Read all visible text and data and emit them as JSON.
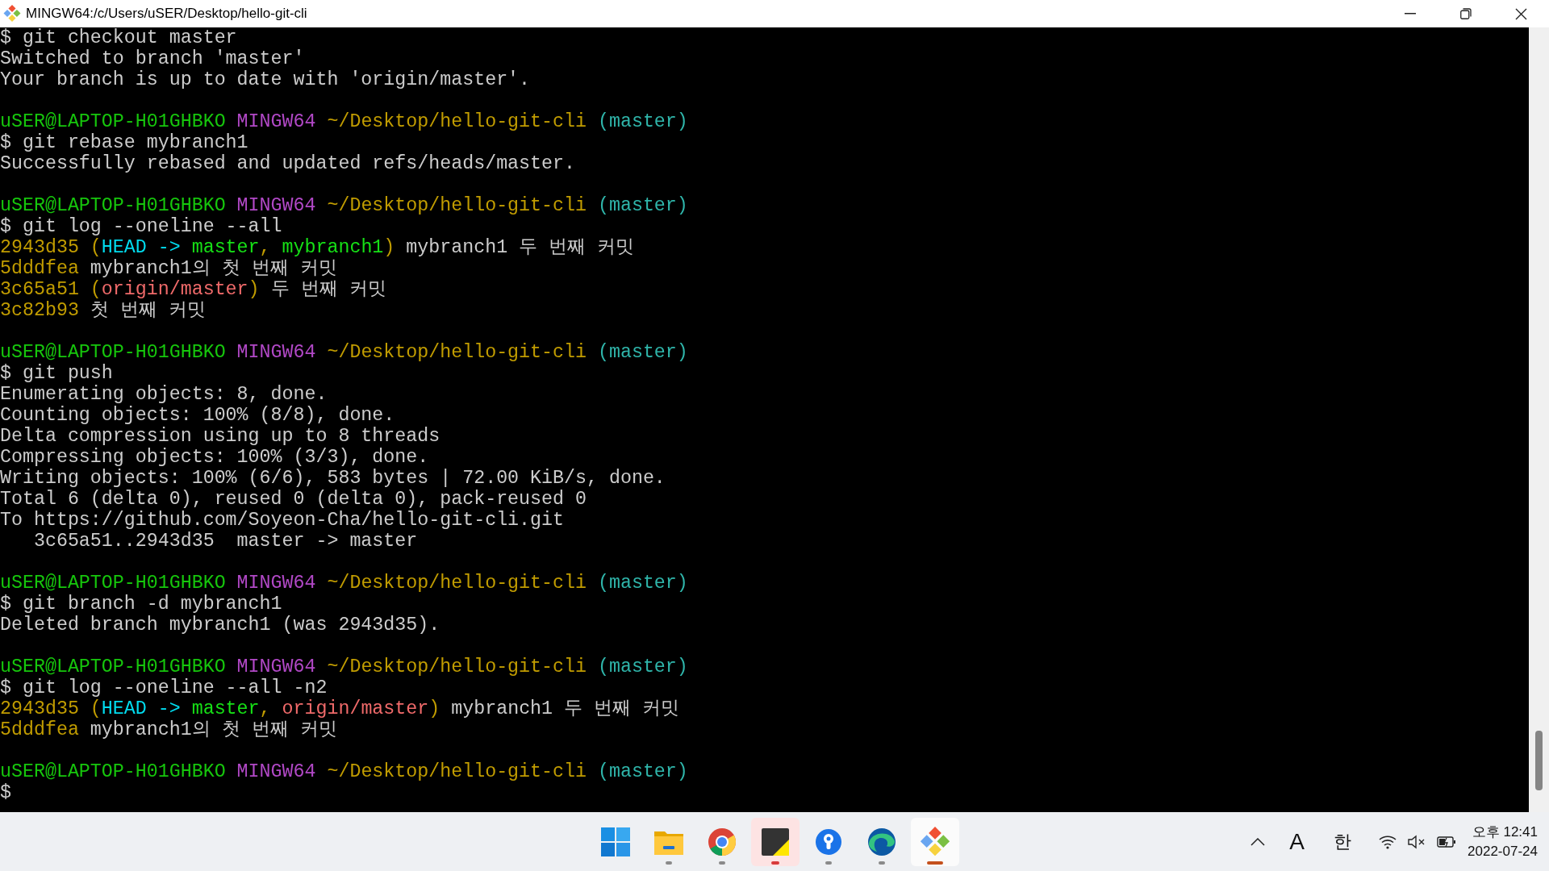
{
  "window": {
    "title": "MINGW64:/c/Users/uSER/Desktop/hello-git-cli"
  },
  "terminal": {
    "lines": [
      {
        "kind": "text",
        "segments": [
          {
            "text": "$ git checkout master",
            "color": "#cccccc"
          }
        ]
      },
      {
        "kind": "text",
        "segments": [
          {
            "text": "Switched to branch 'master'",
            "color": "#cccccc"
          }
        ]
      },
      {
        "kind": "text",
        "segments": [
          {
            "text": "Your branch is up to date with 'origin/master'.",
            "color": "#cccccc"
          }
        ]
      },
      {
        "kind": "blank"
      },
      {
        "kind": "text",
        "segments": [
          {
            "text": "uSER@LAPTOP-H01GHBKO ",
            "color": "#16c60c"
          },
          {
            "text": "MINGW64 ",
            "color": "#b148c6"
          },
          {
            "text": "~/Desktop/hello-git-cli ",
            "color": "#c19c00"
          },
          {
            "text": "(master)",
            "color": "#2fb5aa"
          }
        ]
      },
      {
        "kind": "text",
        "segments": [
          {
            "text": "$ git rebase mybranch1",
            "color": "#cccccc"
          }
        ]
      },
      {
        "kind": "text",
        "segments": [
          {
            "text": "Successfully rebased and updated refs/heads/master.",
            "color": "#cccccc"
          }
        ]
      },
      {
        "kind": "blank"
      },
      {
        "kind": "text",
        "segments": [
          {
            "text": "uSER@LAPTOP-H01GHBKO ",
            "color": "#16c60c"
          },
          {
            "text": "MINGW64 ",
            "color": "#b148c6"
          },
          {
            "text": "~/Desktop/hello-git-cli ",
            "color": "#c19c00"
          },
          {
            "text": "(master)",
            "color": "#2fb5aa"
          }
        ]
      },
      {
        "kind": "text",
        "segments": [
          {
            "text": "$ git log --oneline --all",
            "color": "#cccccc"
          }
        ]
      },
      {
        "kind": "text",
        "segments": [
          {
            "text": "2943d35 (",
            "color": "#c19c00"
          },
          {
            "text": "HEAD -> ",
            "color": "#00dcef"
          },
          {
            "text": "master",
            "color": "#16e016"
          },
          {
            "text": ", ",
            "color": "#c19c00"
          },
          {
            "text": "mybranch1",
            "color": "#16e016"
          },
          {
            "text": ")",
            "color": "#c19c00"
          },
          {
            "text": " mybranch1 두 번째 커밋",
            "color": "#cccccc"
          }
        ]
      },
      {
        "kind": "text",
        "segments": [
          {
            "text": "5dddfea ",
            "color": "#c19c00"
          },
          {
            "text": "mybranch1의 첫 번째 커밋",
            "color": "#cccccc"
          }
        ]
      },
      {
        "kind": "text",
        "segments": [
          {
            "text": "3c65a51 (",
            "color": "#c19c00"
          },
          {
            "text": "origin/master",
            "color": "#f06a6a"
          },
          {
            "text": ")",
            "color": "#c19c00"
          },
          {
            "text": " 두 번째 커밋",
            "color": "#cccccc"
          }
        ]
      },
      {
        "kind": "text",
        "segments": [
          {
            "text": "3c82b93 ",
            "color": "#c19c00"
          },
          {
            "text": "첫 번째 커밋",
            "color": "#cccccc"
          }
        ]
      },
      {
        "kind": "blank"
      },
      {
        "kind": "text",
        "segments": [
          {
            "text": "uSER@LAPTOP-H01GHBKO ",
            "color": "#16c60c"
          },
          {
            "text": "MINGW64 ",
            "color": "#b148c6"
          },
          {
            "text": "~/Desktop/hello-git-cli ",
            "color": "#c19c00"
          },
          {
            "text": "(master)",
            "color": "#2fb5aa"
          }
        ]
      },
      {
        "kind": "text",
        "segments": [
          {
            "text": "$ git push",
            "color": "#cccccc"
          }
        ]
      },
      {
        "kind": "text",
        "segments": [
          {
            "text": "Enumerating objects: 8, done.",
            "color": "#cccccc"
          }
        ]
      },
      {
        "kind": "text",
        "segments": [
          {
            "text": "Counting objects: 100% (8/8), done.",
            "color": "#cccccc"
          }
        ]
      },
      {
        "kind": "text",
        "segments": [
          {
            "text": "Delta compression using up to 8 threads",
            "color": "#cccccc"
          }
        ]
      },
      {
        "kind": "text",
        "segments": [
          {
            "text": "Compressing objects: 100% (3/3), done.",
            "color": "#cccccc"
          }
        ]
      },
      {
        "kind": "text",
        "segments": [
          {
            "text": "Writing objects: 100% (6/6), 583 bytes | 72.00 KiB/s, done.",
            "color": "#cccccc"
          }
        ]
      },
      {
        "kind": "text",
        "segments": [
          {
            "text": "Total 6 (delta 0), reused 0 (delta 0), pack-reused 0",
            "color": "#cccccc"
          }
        ]
      },
      {
        "kind": "text",
        "segments": [
          {
            "text": "To https://github.com/Soyeon-Cha/hello-git-cli.git",
            "color": "#cccccc"
          }
        ]
      },
      {
        "kind": "text",
        "segments": [
          {
            "text": "   3c65a51..2943d35  master -> master",
            "color": "#cccccc"
          }
        ]
      },
      {
        "kind": "blank"
      },
      {
        "kind": "text",
        "segments": [
          {
            "text": "uSER@LAPTOP-H01GHBKO ",
            "color": "#16c60c"
          },
          {
            "text": "MINGW64 ",
            "color": "#b148c6"
          },
          {
            "text": "~/Desktop/hello-git-cli ",
            "color": "#c19c00"
          },
          {
            "text": "(master)",
            "color": "#2fb5aa"
          }
        ]
      },
      {
        "kind": "text",
        "segments": [
          {
            "text": "$ git branch -d mybranch1",
            "color": "#cccccc"
          }
        ]
      },
      {
        "kind": "text",
        "segments": [
          {
            "text": "Deleted branch mybranch1 (was 2943d35).",
            "color": "#cccccc"
          }
        ]
      },
      {
        "kind": "blank"
      },
      {
        "kind": "text",
        "segments": [
          {
            "text": "uSER@LAPTOP-H01GHBKO ",
            "color": "#16c60c"
          },
          {
            "text": "MINGW64 ",
            "color": "#b148c6"
          },
          {
            "text": "~/Desktop/hello-git-cli ",
            "color": "#c19c00"
          },
          {
            "text": "(master)",
            "color": "#2fb5aa"
          }
        ]
      },
      {
        "kind": "text",
        "segments": [
          {
            "text": "$ git log --oneline --all -n2",
            "color": "#cccccc"
          }
        ]
      },
      {
        "kind": "text",
        "segments": [
          {
            "text": "2943d35 (",
            "color": "#c19c00"
          },
          {
            "text": "HEAD -> ",
            "color": "#00dcef"
          },
          {
            "text": "master",
            "color": "#16e016"
          },
          {
            "text": ", ",
            "color": "#c19c00"
          },
          {
            "text": "origin/master",
            "color": "#f06a6a"
          },
          {
            "text": ")",
            "color": "#c19c00"
          },
          {
            "text": " mybranch1 두 번째 커밋",
            "color": "#cccccc"
          }
        ]
      },
      {
        "kind": "text",
        "segments": [
          {
            "text": "5dddfea ",
            "color": "#c19c00"
          },
          {
            "text": "mybranch1의 첫 번째 커밋",
            "color": "#cccccc"
          }
        ]
      },
      {
        "kind": "blank"
      },
      {
        "kind": "text",
        "segments": [
          {
            "text": "uSER@LAPTOP-H01GHBKO ",
            "color": "#16c60c"
          },
          {
            "text": "MINGW64 ",
            "color": "#b148c6"
          },
          {
            "text": "~/Desktop/hello-git-cli ",
            "color": "#c19c00"
          },
          {
            "text": "(master)",
            "color": "#2fb5aa"
          }
        ]
      },
      {
        "kind": "text",
        "segments": [
          {
            "text": "$",
            "color": "#cccccc"
          }
        ]
      }
    ]
  },
  "taskbar": {
    "apps": [
      {
        "kind": "start",
        "running": false,
        "attention": false,
        "selected": false
      },
      {
        "kind": "folder",
        "running": true,
        "attention": false,
        "selected": false
      },
      {
        "kind": "browser",
        "running": true,
        "attention": false,
        "selected": false
      },
      {
        "kind": "notes",
        "running": true,
        "attention": true,
        "selected": false
      },
      {
        "kind": "keyhole",
        "running": true,
        "attention": false,
        "selected": false
      },
      {
        "kind": "edge",
        "running": true,
        "attention": false,
        "selected": false
      },
      {
        "kind": "git",
        "running": true,
        "attention": false,
        "selected": true
      }
    ],
    "tray": {
      "input_mode": "A",
      "language": "한",
      "time": "오후 12:41",
      "date": "2022-07-24"
    }
  }
}
